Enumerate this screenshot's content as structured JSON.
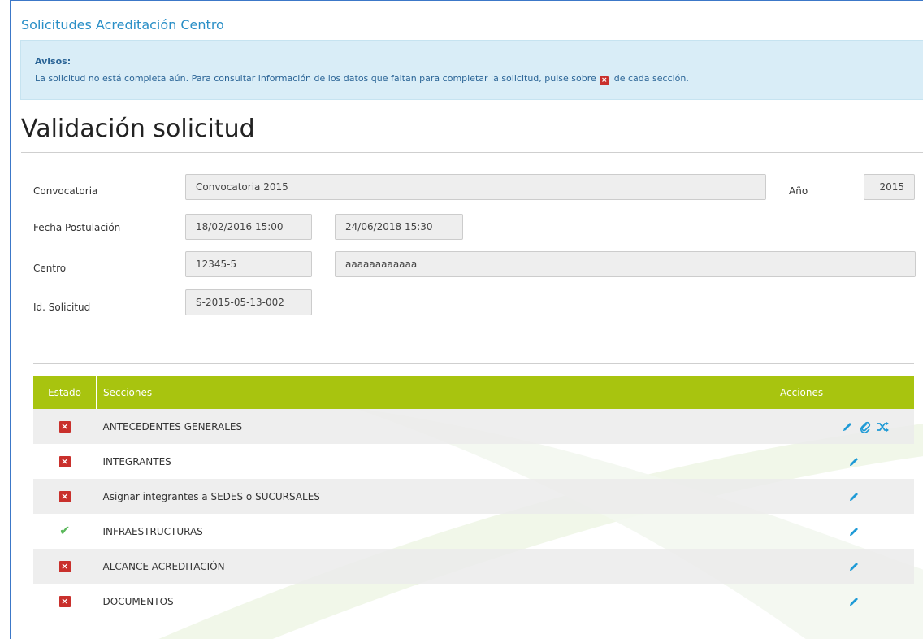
{
  "app": {
    "title": "Solicitudes Acreditación Centro"
  },
  "alert": {
    "title": "Avisos:",
    "text_before": "La solicitud no está completa aún. Para consultar información de los datos que faltan para completar la solicitud, pulse sobre",
    "text_after": "de cada sección."
  },
  "page": {
    "title": "Validación solicitud"
  },
  "form": {
    "convocatoria_label": "Convocatoria",
    "convocatoria_value": "Convocatoria 2015",
    "anio_label": "Año",
    "anio_value": "2015",
    "fecha_label": "Fecha Postulación",
    "fecha_desde": "18/02/2016 15:00",
    "fecha_hasta": "24/06/2018 15:30",
    "centro_label": "Centro",
    "centro_code": "12345-5",
    "centro_name": "aaaaaaaaaaaa",
    "id_label": "Id. Solicitud",
    "id_value": "S-2015-05-13-002"
  },
  "table": {
    "headers": {
      "estado": "Estado",
      "secciones": "Secciones",
      "acciones": "Acciones"
    },
    "rows": [
      {
        "status": "incomplete",
        "section": "ANTECEDENTES GENERALES",
        "actions": [
          "edit-icon",
          "attach-icon",
          "shuffle-icon"
        ]
      },
      {
        "status": "incomplete",
        "section": "INTEGRANTES",
        "actions": [
          "edit-icon"
        ]
      },
      {
        "status": "incomplete",
        "section": "Asignar integrantes a SEDES o SUCURSALES",
        "actions": [
          "edit-icon"
        ]
      },
      {
        "status": "complete",
        "section": "INFRAESTRUCTURAS",
        "actions": [
          "edit-icon"
        ]
      },
      {
        "status": "incomplete",
        "section": "ALCANCE ACREDITACIÓN",
        "actions": [
          "edit-icon"
        ]
      },
      {
        "status": "incomplete",
        "section": "DOCUMENTOS",
        "actions": [
          "edit-icon"
        ]
      }
    ]
  },
  "colors": {
    "accent": "#2a8fc7",
    "header_green": "#a8c40f",
    "alert_bg": "#d9edf7",
    "error_red": "#c9302c",
    "ok_green": "#5cb85c"
  }
}
